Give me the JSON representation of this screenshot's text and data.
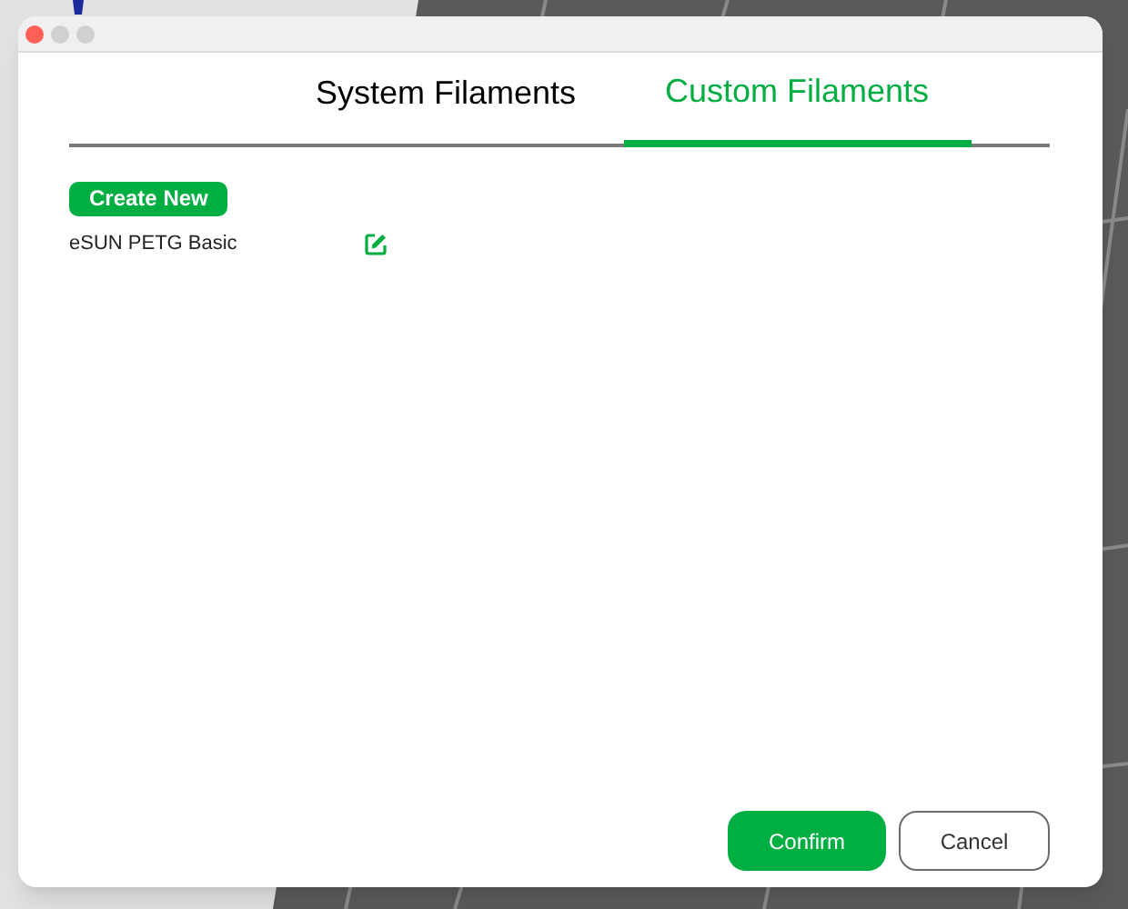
{
  "tabs": [
    {
      "label": "System Filaments",
      "selected": false
    },
    {
      "label": "Custom Filaments",
      "selected": true
    }
  ],
  "create_button": "Create New",
  "filaments": [
    {
      "name": "eSUN PETG Basic"
    }
  ],
  "buttons": {
    "confirm": "Confirm",
    "cancel": "Cancel"
  }
}
